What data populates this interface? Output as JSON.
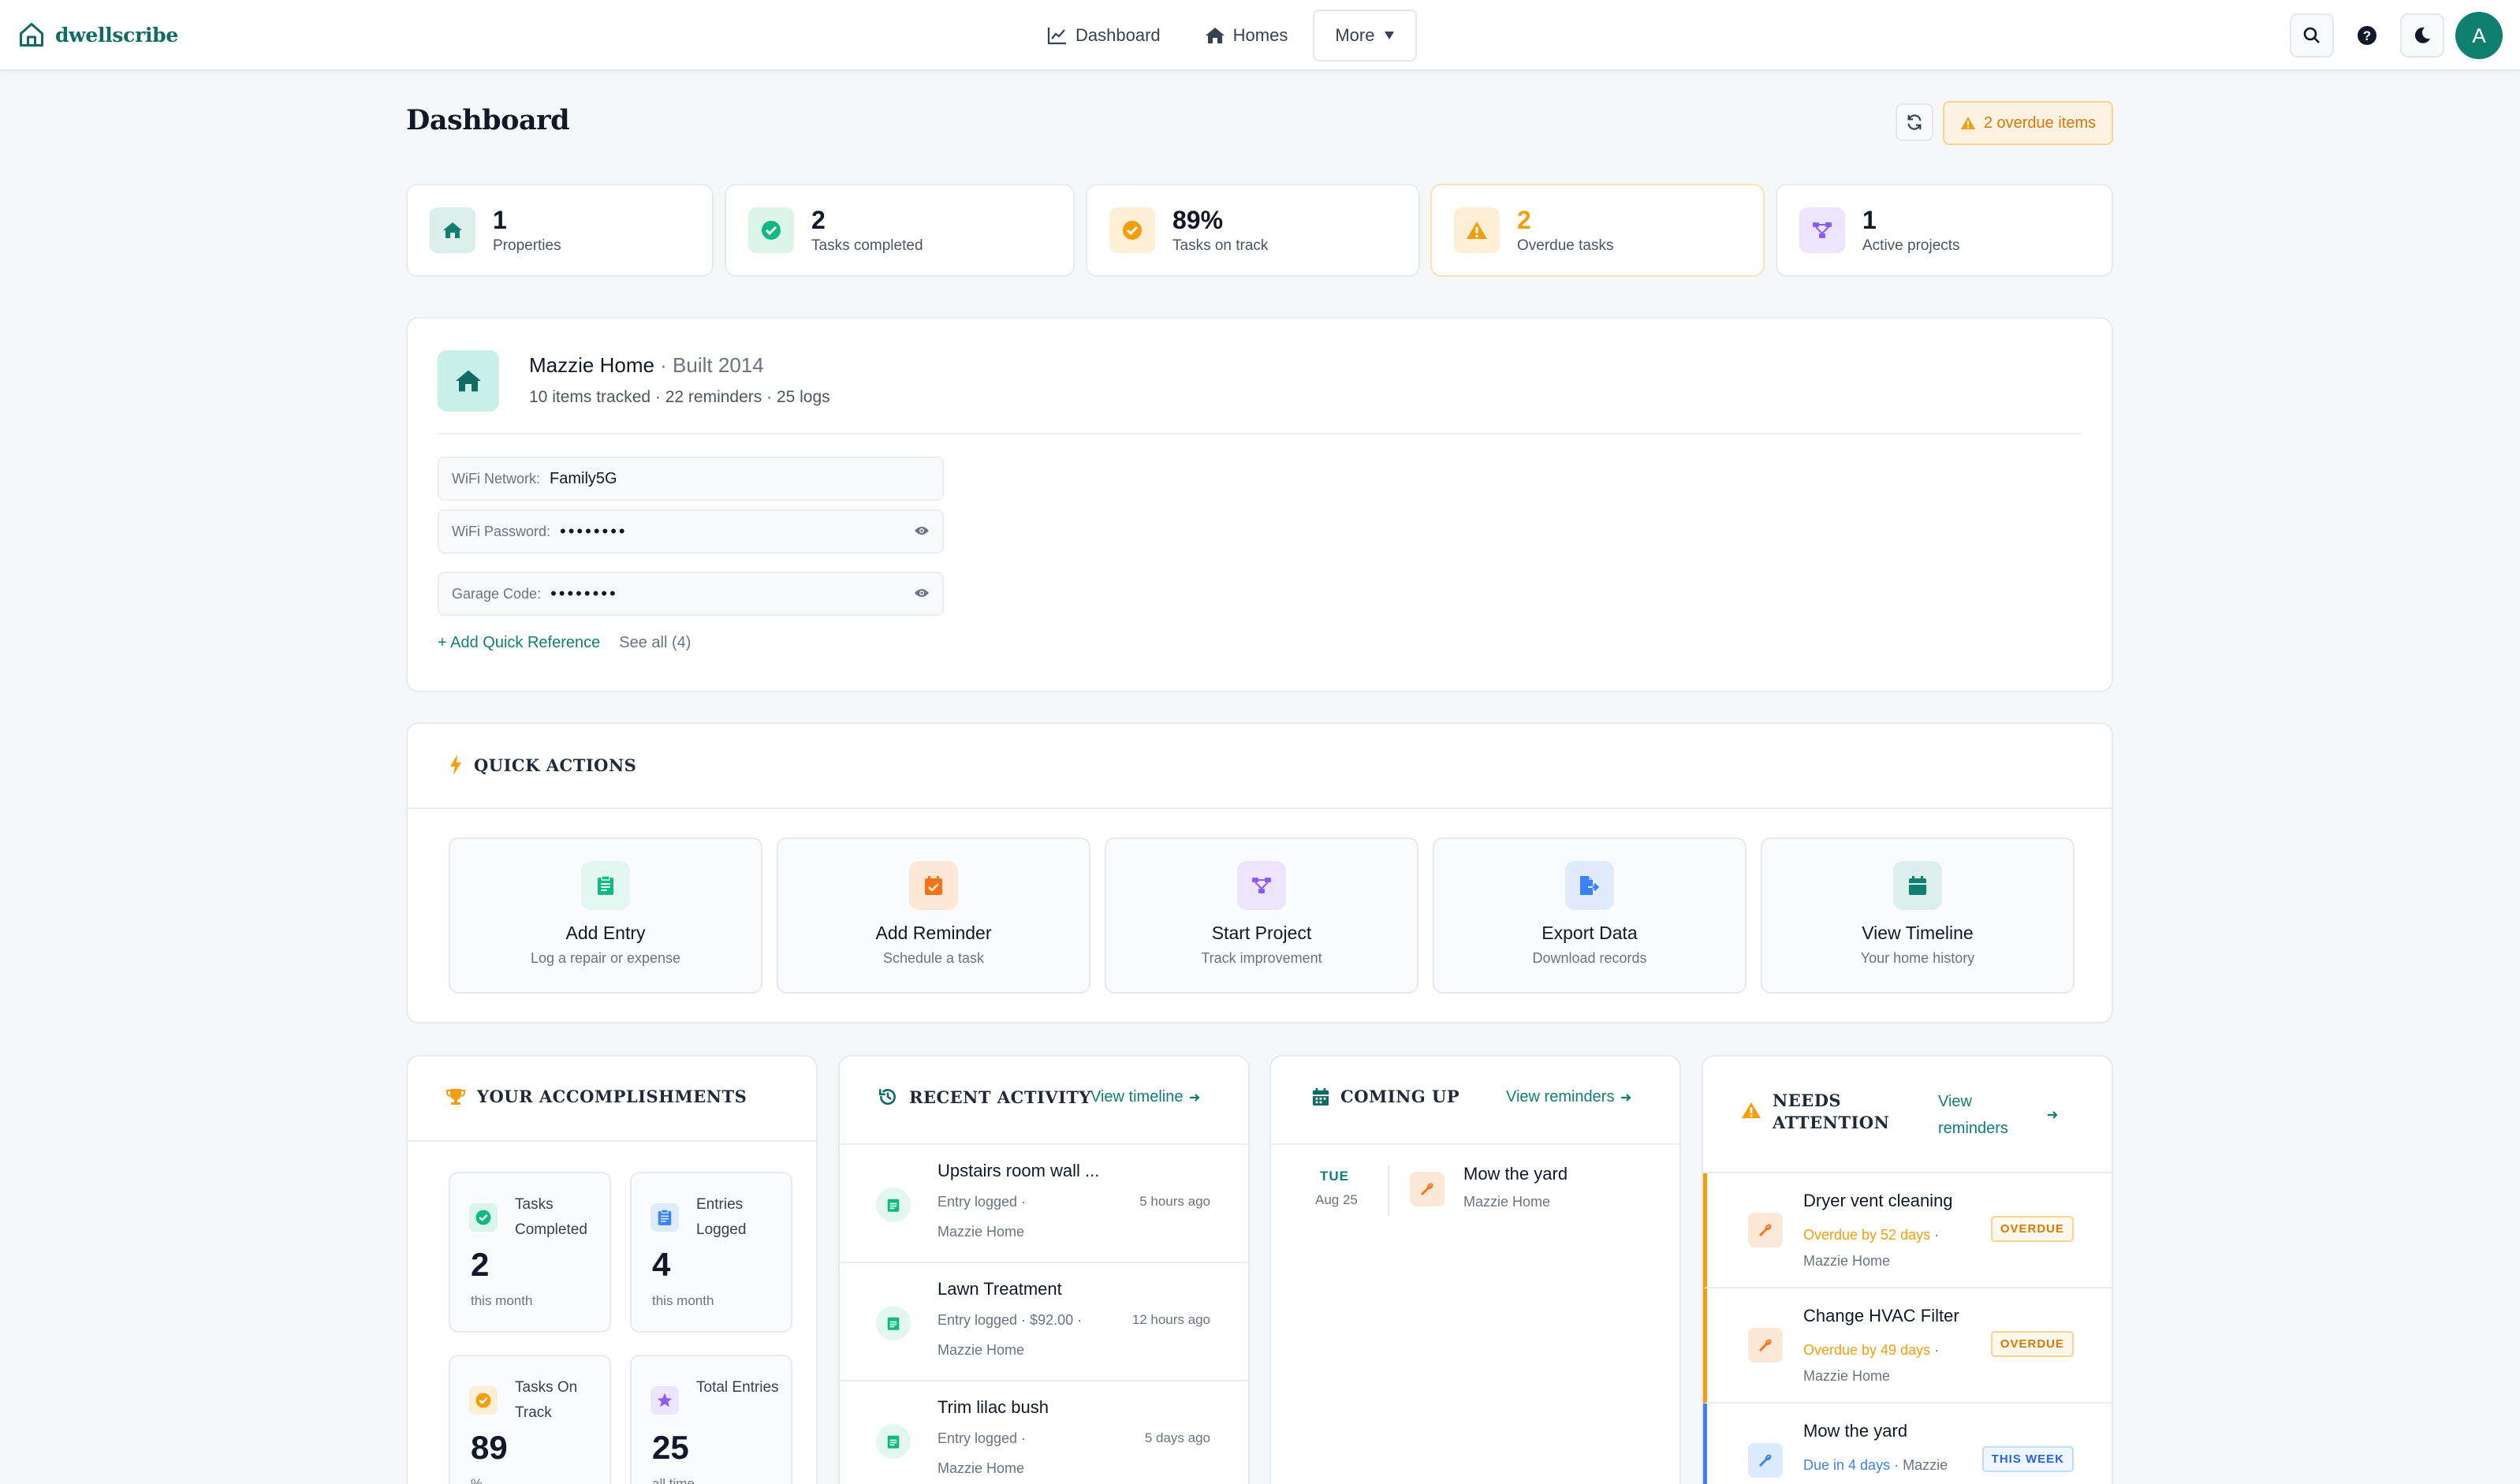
{
  "nav": {
    "brand": "dwellscribe",
    "links": [
      "Dashboard",
      "Homes"
    ],
    "more": "More",
    "avatar_initial": "A"
  },
  "header": {
    "title": "Dashboard",
    "overdue_label": "2 overdue items"
  },
  "stats": [
    {
      "value": "1",
      "label": "Properties",
      "icon": "home-icon",
      "color": "#0f7f70"
    },
    {
      "value": "2",
      "label": "Tasks completed",
      "icon": "check-circle-icon",
      "color": "#10b981"
    },
    {
      "value": "89%",
      "label": "Tasks on track",
      "icon": "check-circle-icon",
      "color": "#f59e0b"
    },
    {
      "value": "2",
      "label": "Overdue tasks",
      "icon": "warning-icon",
      "color": "#f59e0b"
    },
    {
      "value": "1",
      "label": "Active projects",
      "icon": "project-icon",
      "color": "#8b5cf6"
    }
  ],
  "property": {
    "name": "Mazzie Home",
    "built": "· Built 2014",
    "meta": "10 items tracked · 22 reminders · 25 logs",
    "refs": [
      {
        "label": "WiFi Network:",
        "value": "Family5G"
      },
      {
        "label": "WiFi Password:",
        "value": "••••••••"
      },
      {
        "label": "Garage Code:",
        "value": "••••••••"
      }
    ],
    "add_ref": "+ Add Quick Reference",
    "see_all": "See all (4)"
  },
  "quick_actions": {
    "title": "Quick Actions",
    "items": [
      {
        "label": "Add Entry",
        "sub": "Log a repair or expense",
        "icon": "clipboard-icon",
        "color": "#10b981",
        "bg": "#e3f6ef"
      },
      {
        "label": "Add Reminder",
        "sub": "Schedule a task",
        "icon": "calendar-check-icon",
        "color": "#f97316",
        "bg": "#fde8d7"
      },
      {
        "label": "Start Project",
        "sub": "Track improvement",
        "icon": "project-icon",
        "color": "#8b5cf6",
        "bg": "#ede5fd"
      },
      {
        "label": "Export Data",
        "sub": "Download records",
        "icon": "file-export-icon",
        "color": "#3b82f6",
        "bg": "#dfeafc"
      },
      {
        "label": "View Timeline",
        "sub": "Your home history",
        "icon": "calendar-icon",
        "color": "#0f7f70",
        "bg": "#dcefeb"
      }
    ]
  },
  "accomplishments": {
    "title": "Your Accomplishments",
    "items": [
      {
        "label": "Tasks Completed",
        "value": "2",
        "sub": "this month",
        "color": "#10b981",
        "bg": "#dcf5ea"
      },
      {
        "label": "Entries Logged",
        "value": "4",
        "sub": "this month",
        "color": "#3b82f6",
        "bg": "#dfeafc"
      },
      {
        "label": "Tasks On Track",
        "value": "89",
        "sub": "%",
        "color": "#f59e0b",
        "bg": "#fdefd6"
      },
      {
        "label": "Total Entries",
        "value": "25",
        "sub": "all time",
        "color": "#8b5cf6",
        "bg": "#ede5fd"
      }
    ]
  },
  "recent_activity": {
    "title": "Recent Activity",
    "link": "View timeline",
    "items": [
      {
        "title": "Upstairs room wall ...",
        "meta": "Entry logged ·",
        "property": "Mazzie Home",
        "time": "5 hours ago"
      },
      {
        "title": "Lawn Treatment",
        "meta": "Entry logged · $92.00 ·",
        "property": "Mazzie Home",
        "time": "12 hours ago"
      },
      {
        "title": "Trim lilac bush",
        "meta": "Entry logged ·",
        "property": "Mazzie Home",
        "time": "5 days ago"
      }
    ]
  },
  "coming_up": {
    "title": "Coming Up",
    "link": "View reminders",
    "items": [
      {
        "day": "TUE",
        "date": "Aug 25",
        "title": "Mow the yard",
        "property": "Mazzie Home"
      }
    ]
  },
  "needs_attention": {
    "title": "Needs Attention",
    "link": "View reminders",
    "items": [
      {
        "title": "Dryer vent cleaning",
        "status": "Overdue by 52 days",
        "property": "Mazzie Home",
        "badge": "OVERDUE"
      },
      {
        "title": "Change HVAC Filter",
        "status": "Overdue by 49 days",
        "property": "Mazzie Home",
        "badge": "OVERDUE"
      },
      {
        "title": "Mow the yard",
        "status": "Due in 4 days",
        "property": "Mazzie",
        "badge": "THIS WEEK"
      }
    ]
  }
}
